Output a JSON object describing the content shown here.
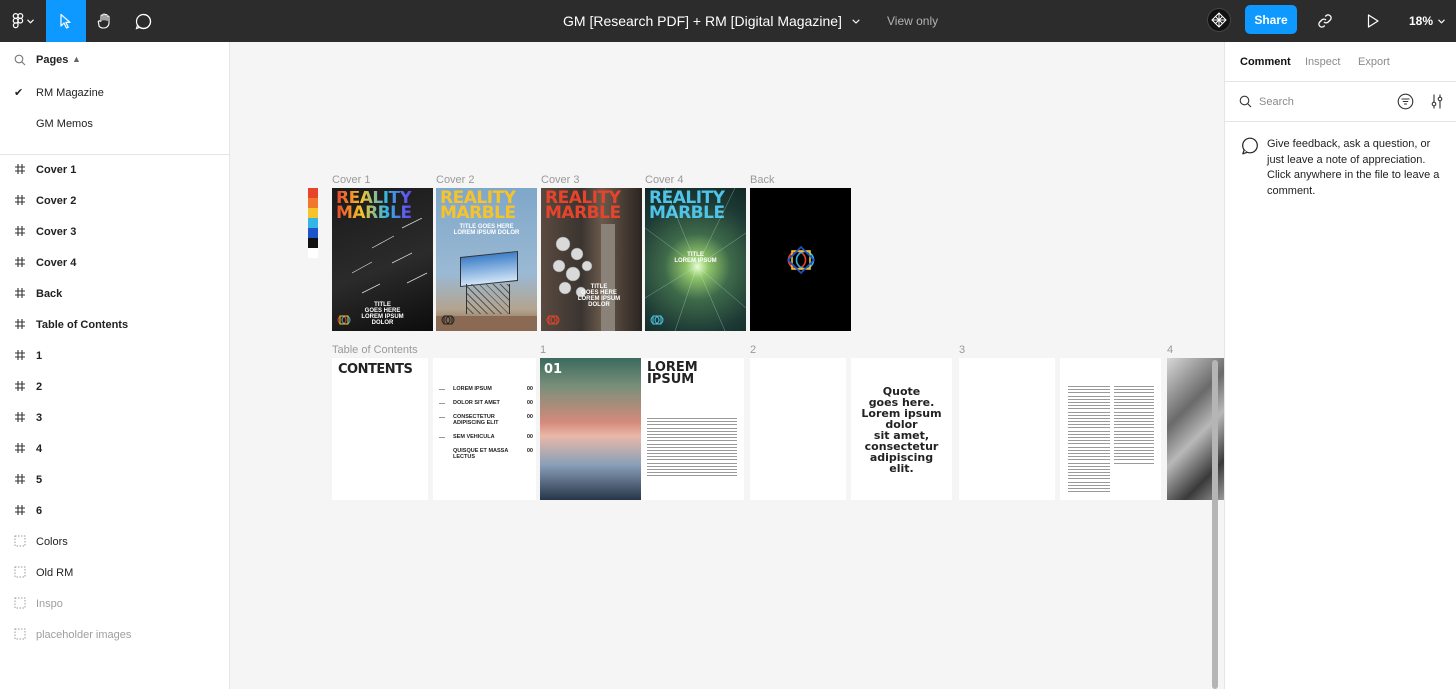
{
  "topbar": {
    "title": "GM [Research PDF] + RM [Digital Magazine]",
    "view_only": "View only",
    "share": "Share",
    "zoom": "18%"
  },
  "pages": {
    "header": "Pages",
    "items": [
      {
        "label": "RM Magazine",
        "selected": true
      },
      {
        "label": "GM Memos",
        "selected": false
      }
    ]
  },
  "layers": [
    {
      "label": "Cover 1",
      "kind": "frame"
    },
    {
      "label": "Cover 2",
      "kind": "frame"
    },
    {
      "label": "Cover 3",
      "kind": "frame"
    },
    {
      "label": "Cover 4",
      "kind": "frame"
    },
    {
      "label": "Back",
      "kind": "frame"
    },
    {
      "label": "Table of Contents",
      "kind": "frame"
    },
    {
      "label": "1",
      "kind": "frame"
    },
    {
      "label": "2",
      "kind": "frame"
    },
    {
      "label": "3",
      "kind": "frame"
    },
    {
      "label": "4",
      "kind": "frame"
    },
    {
      "label": "5",
      "kind": "frame"
    },
    {
      "label": "6",
      "kind": "frame"
    },
    {
      "label": "Colors",
      "kind": "section"
    },
    {
      "label": "Old RM",
      "kind": "section"
    },
    {
      "label": "Inspo",
      "kind": "hidden"
    },
    {
      "label": "placeholder images",
      "kind": "hidden"
    }
  ],
  "canvas": {
    "frame_labels": {
      "cover1": "Cover 1",
      "cover2": "Cover 2",
      "cover3": "Cover 3",
      "cover4": "Cover 4",
      "back": "Back",
      "toc": "Table of Contents",
      "p1": "1",
      "p2": "2",
      "p3": "3",
      "p4": "4"
    },
    "palette_colors": [
      "#e8442c",
      "#f0772b",
      "#f7c32a",
      "#33b5e5",
      "#1f53c9",
      "#111111",
      "#ffffff"
    ],
    "cover": {
      "title_line1": "REALITY",
      "title_line2": "MARBLE",
      "headline1": "TITLE",
      "headline2": "GOES HERE",
      "headline3": "LOREM IPSUM",
      "headline4": "DOLOR",
      "cover2_headline1": "TITLE GOES HERE",
      "cover2_headline2": "LOREM IPSUM DOLOR"
    },
    "toc": {
      "title": "CONTENTS",
      "entries": [
        {
          "label": "LOREM IPSUM",
          "page": "00"
        },
        {
          "label": "DOLOR SIT AMET",
          "page": "00"
        },
        {
          "label": "CONSECTETUR",
          "label2": "ADIPISCING ELIT",
          "page": "00"
        },
        {
          "label": "SEM VEHICULA",
          "page": "00"
        },
        {
          "label": "QUISQUE ET MASSA",
          "label2": "LECTUS",
          "page": "00"
        }
      ]
    },
    "spread1": {
      "number": "01",
      "title1": "LOREM",
      "title2": "IPSUM"
    },
    "quote": {
      "l1": "Quote",
      "l2": "goes here.",
      "l3": "Lorem ipsum",
      "l4": "dolor",
      "l5": "sit amet,",
      "l6": "consectetur",
      "l7": "adipiscing",
      "l8": "elit."
    }
  },
  "right": {
    "tabs": {
      "comment": "Comment",
      "inspect": "Inspect",
      "export": "Export"
    },
    "search_placeholder": "Search",
    "hint": "Give feedback, ask a question, or just leave a note of appreciation. Click anywhere in the file to leave a comment."
  },
  "colors": {
    "accent": "#0d99ff",
    "topbar": "#2c2c2c"
  }
}
